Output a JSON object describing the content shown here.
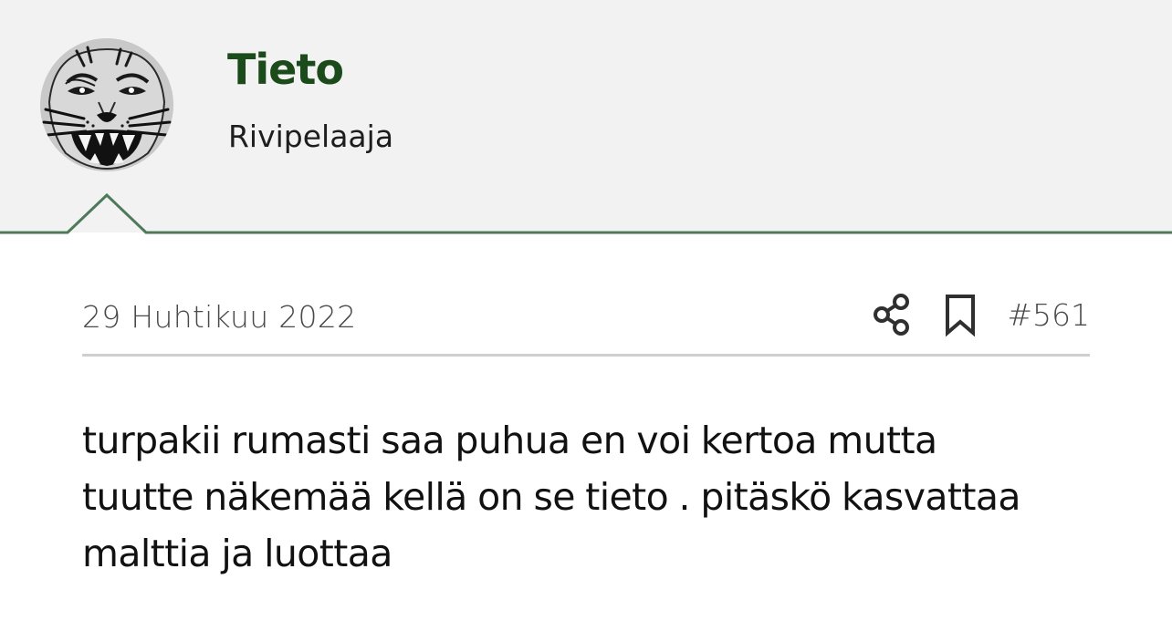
{
  "user": {
    "name": "Tieto",
    "title": "Rivipelaaja",
    "avatar_icon": "tiger-face-avatar-icon"
  },
  "post": {
    "date": "29 Huhtikuu 2022",
    "number": "#561",
    "share_icon": "share-icon",
    "bookmark_icon": "bookmark-icon",
    "body_lines": [
      "turpakii rumasti saa puhua en voi kertoa mutta",
      "tuutte näkemää kellä on se tieto . pitäskö kasvattaa",
      "malttia ja luottaa"
    ]
  },
  "colors": {
    "header_bg": "#f2f2f2",
    "accent_border": "#4f7a5a",
    "username": "#1b4a1b",
    "meta_text": "#4a4a4a",
    "divider": "#cfcfcf"
  }
}
